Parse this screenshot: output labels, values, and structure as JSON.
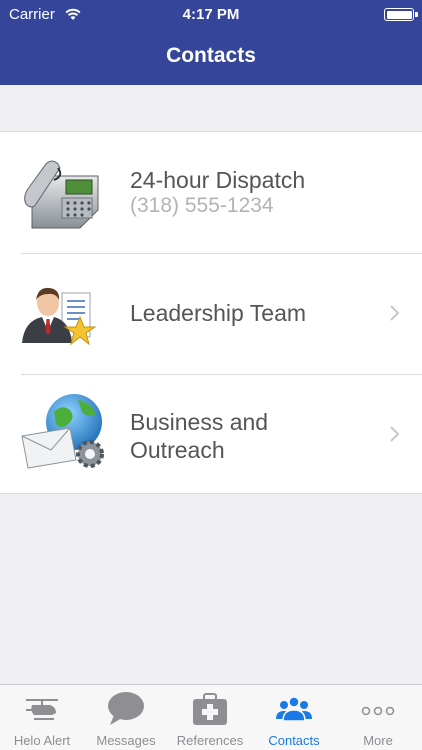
{
  "status": {
    "carrier": "Carrier",
    "time": "4:17 PM"
  },
  "nav": {
    "title": "Contacts"
  },
  "contacts": [
    {
      "title": "24-hour Dispatch",
      "subtitle": "(318) 555-1234",
      "icon": "desk-phone-icon"
    },
    {
      "title": "Leadership Team",
      "icon": "businessman-star-icon",
      "has_chevron": true
    },
    {
      "title_line1": "Business and",
      "title_line2": "Outreach",
      "icon": "globe-mail-gear-icon",
      "has_chevron": true
    }
  ],
  "tabs": [
    {
      "label": "Helo Alert",
      "icon": "helicopter-icon"
    },
    {
      "label": "Messages",
      "icon": "speech-bubble-icon"
    },
    {
      "label": "References",
      "icon": "medical-kit-icon"
    },
    {
      "label": "Contacts",
      "icon": "people-icon",
      "active": true
    },
    {
      "label": "More",
      "icon": "more-dots-icon"
    }
  ],
  "colors": {
    "nav_bar": "#35469a",
    "active_tab": "#1a7ae6",
    "inactive_tab": "#8e8e93"
  }
}
